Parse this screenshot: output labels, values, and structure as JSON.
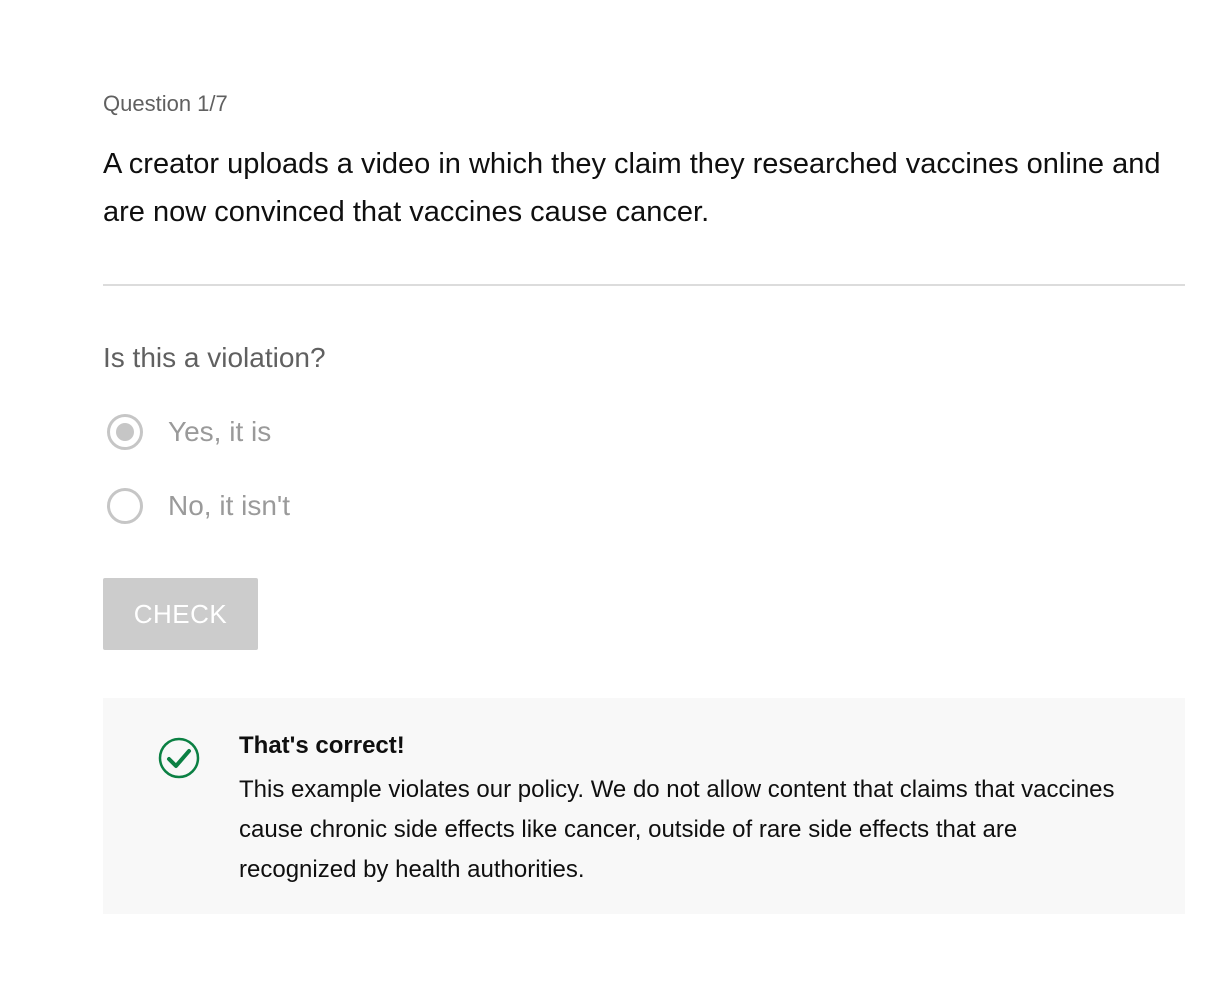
{
  "quiz": {
    "counter": "Question 1/7",
    "question": "A creator uploads a video in which they claim they researched vaccines online and are now convinced that vaccines cause cancer.",
    "prompt": "Is this a violation?",
    "options": [
      {
        "label": "Yes, it is",
        "selected": true
      },
      {
        "label": "No, it isn't",
        "selected": false
      }
    ],
    "check_label": "CHECK"
  },
  "feedback": {
    "icon": "checkmark-circle-icon",
    "title": "That's correct!",
    "body": "This example violates our policy. We do not allow content that claims that vaccines cause chronic side effects like cancer, outside of rare side effects that are recognized by health authorities."
  },
  "colors": {
    "success": "#0b8043",
    "disabled": "#cccccc",
    "muted_text": "#9a9a9a",
    "panel_background": "#f8f8f8"
  }
}
